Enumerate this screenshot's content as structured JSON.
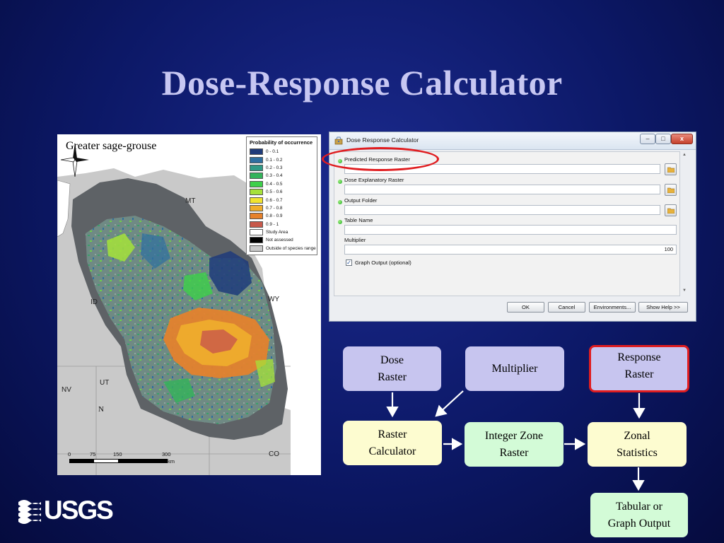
{
  "slide": {
    "title": "Dose-Response Calculator"
  },
  "map": {
    "caption": "Greater sage-grouse",
    "states": [
      "MT",
      "ID",
      "WY",
      "UT",
      "NV",
      "CO"
    ],
    "legend": {
      "title": "Probability of occurrence",
      "items": [
        {
          "label": "0 - 0.1",
          "color": "#1f3b7a"
        },
        {
          "label": "0.1 - 0.2",
          "color": "#2e6fa0"
        },
        {
          "label": "0.2 - 0.3",
          "color": "#2f9a86"
        },
        {
          "label": "0.3 - 0.4",
          "color": "#33b35a"
        },
        {
          "label": "0.4 - 0.5",
          "color": "#3dd04a"
        },
        {
          "label": "0.5 - 0.6",
          "color": "#a6e23a"
        },
        {
          "label": "0.6 - 0.7",
          "color": "#f0e330"
        },
        {
          "label": "0.7 - 0.8",
          "color": "#f0ae2c"
        },
        {
          "label": "0.8 - 0.9",
          "color": "#e6812b"
        },
        {
          "label": "0.9 - 1",
          "color": "#c8584a"
        },
        {
          "label": "Study Area",
          "color": "#ffffff"
        },
        {
          "label": "Not assessed",
          "color": "#000000"
        },
        {
          "label": "Outside of species range",
          "color": "#c9c9c9"
        }
      ]
    },
    "north_label": "N",
    "scale": {
      "ticks": [
        "0",
        "75",
        "150",
        "300"
      ],
      "unit": "km"
    }
  },
  "dialog": {
    "title": "Dose Response Calculator",
    "window_buttons": {
      "minimize": "–",
      "maximize": "□",
      "close": "x"
    },
    "fields": {
      "predicted_response_raster": {
        "label": "Predicted Response Raster",
        "value": ""
      },
      "dose_explanatory_raster": {
        "label": "Dose Explanatory Raster",
        "value": ""
      },
      "output_folder": {
        "label": "Output Folder",
        "value": ""
      },
      "table_name": {
        "label": "Table Name",
        "value": ""
      },
      "multiplier": {
        "label": "Multiplier",
        "value": "100"
      }
    },
    "graph_output": {
      "label": "Graph Output (optional)",
      "checked": true
    },
    "buttons": {
      "ok": "OK",
      "cancel": "Cancel",
      "environments": "Environments...",
      "show_help": "Show Help >>"
    }
  },
  "flow": {
    "dose_raster": [
      "Dose",
      "Raster"
    ],
    "multiplier": [
      "Multiplier"
    ],
    "response_raster": [
      "Response",
      "Raster"
    ],
    "raster_calculator": [
      "Raster",
      "Calculator"
    ],
    "integer_zone_raster": [
      "Integer Zone",
      "Raster"
    ],
    "zonal_statistics": [
      "Zonal",
      "Statistics"
    ],
    "tabular_output": [
      "Tabular or",
      "Graph Output"
    ]
  },
  "logo": {
    "text": "USGS"
  },
  "colors": {
    "background": "#0c1866",
    "title": "#c7c7f2",
    "highlight": "#e01d20",
    "lavender": "#c7c5ef",
    "yellow": "#fdfcd0",
    "green": "#d3fbd7"
  }
}
